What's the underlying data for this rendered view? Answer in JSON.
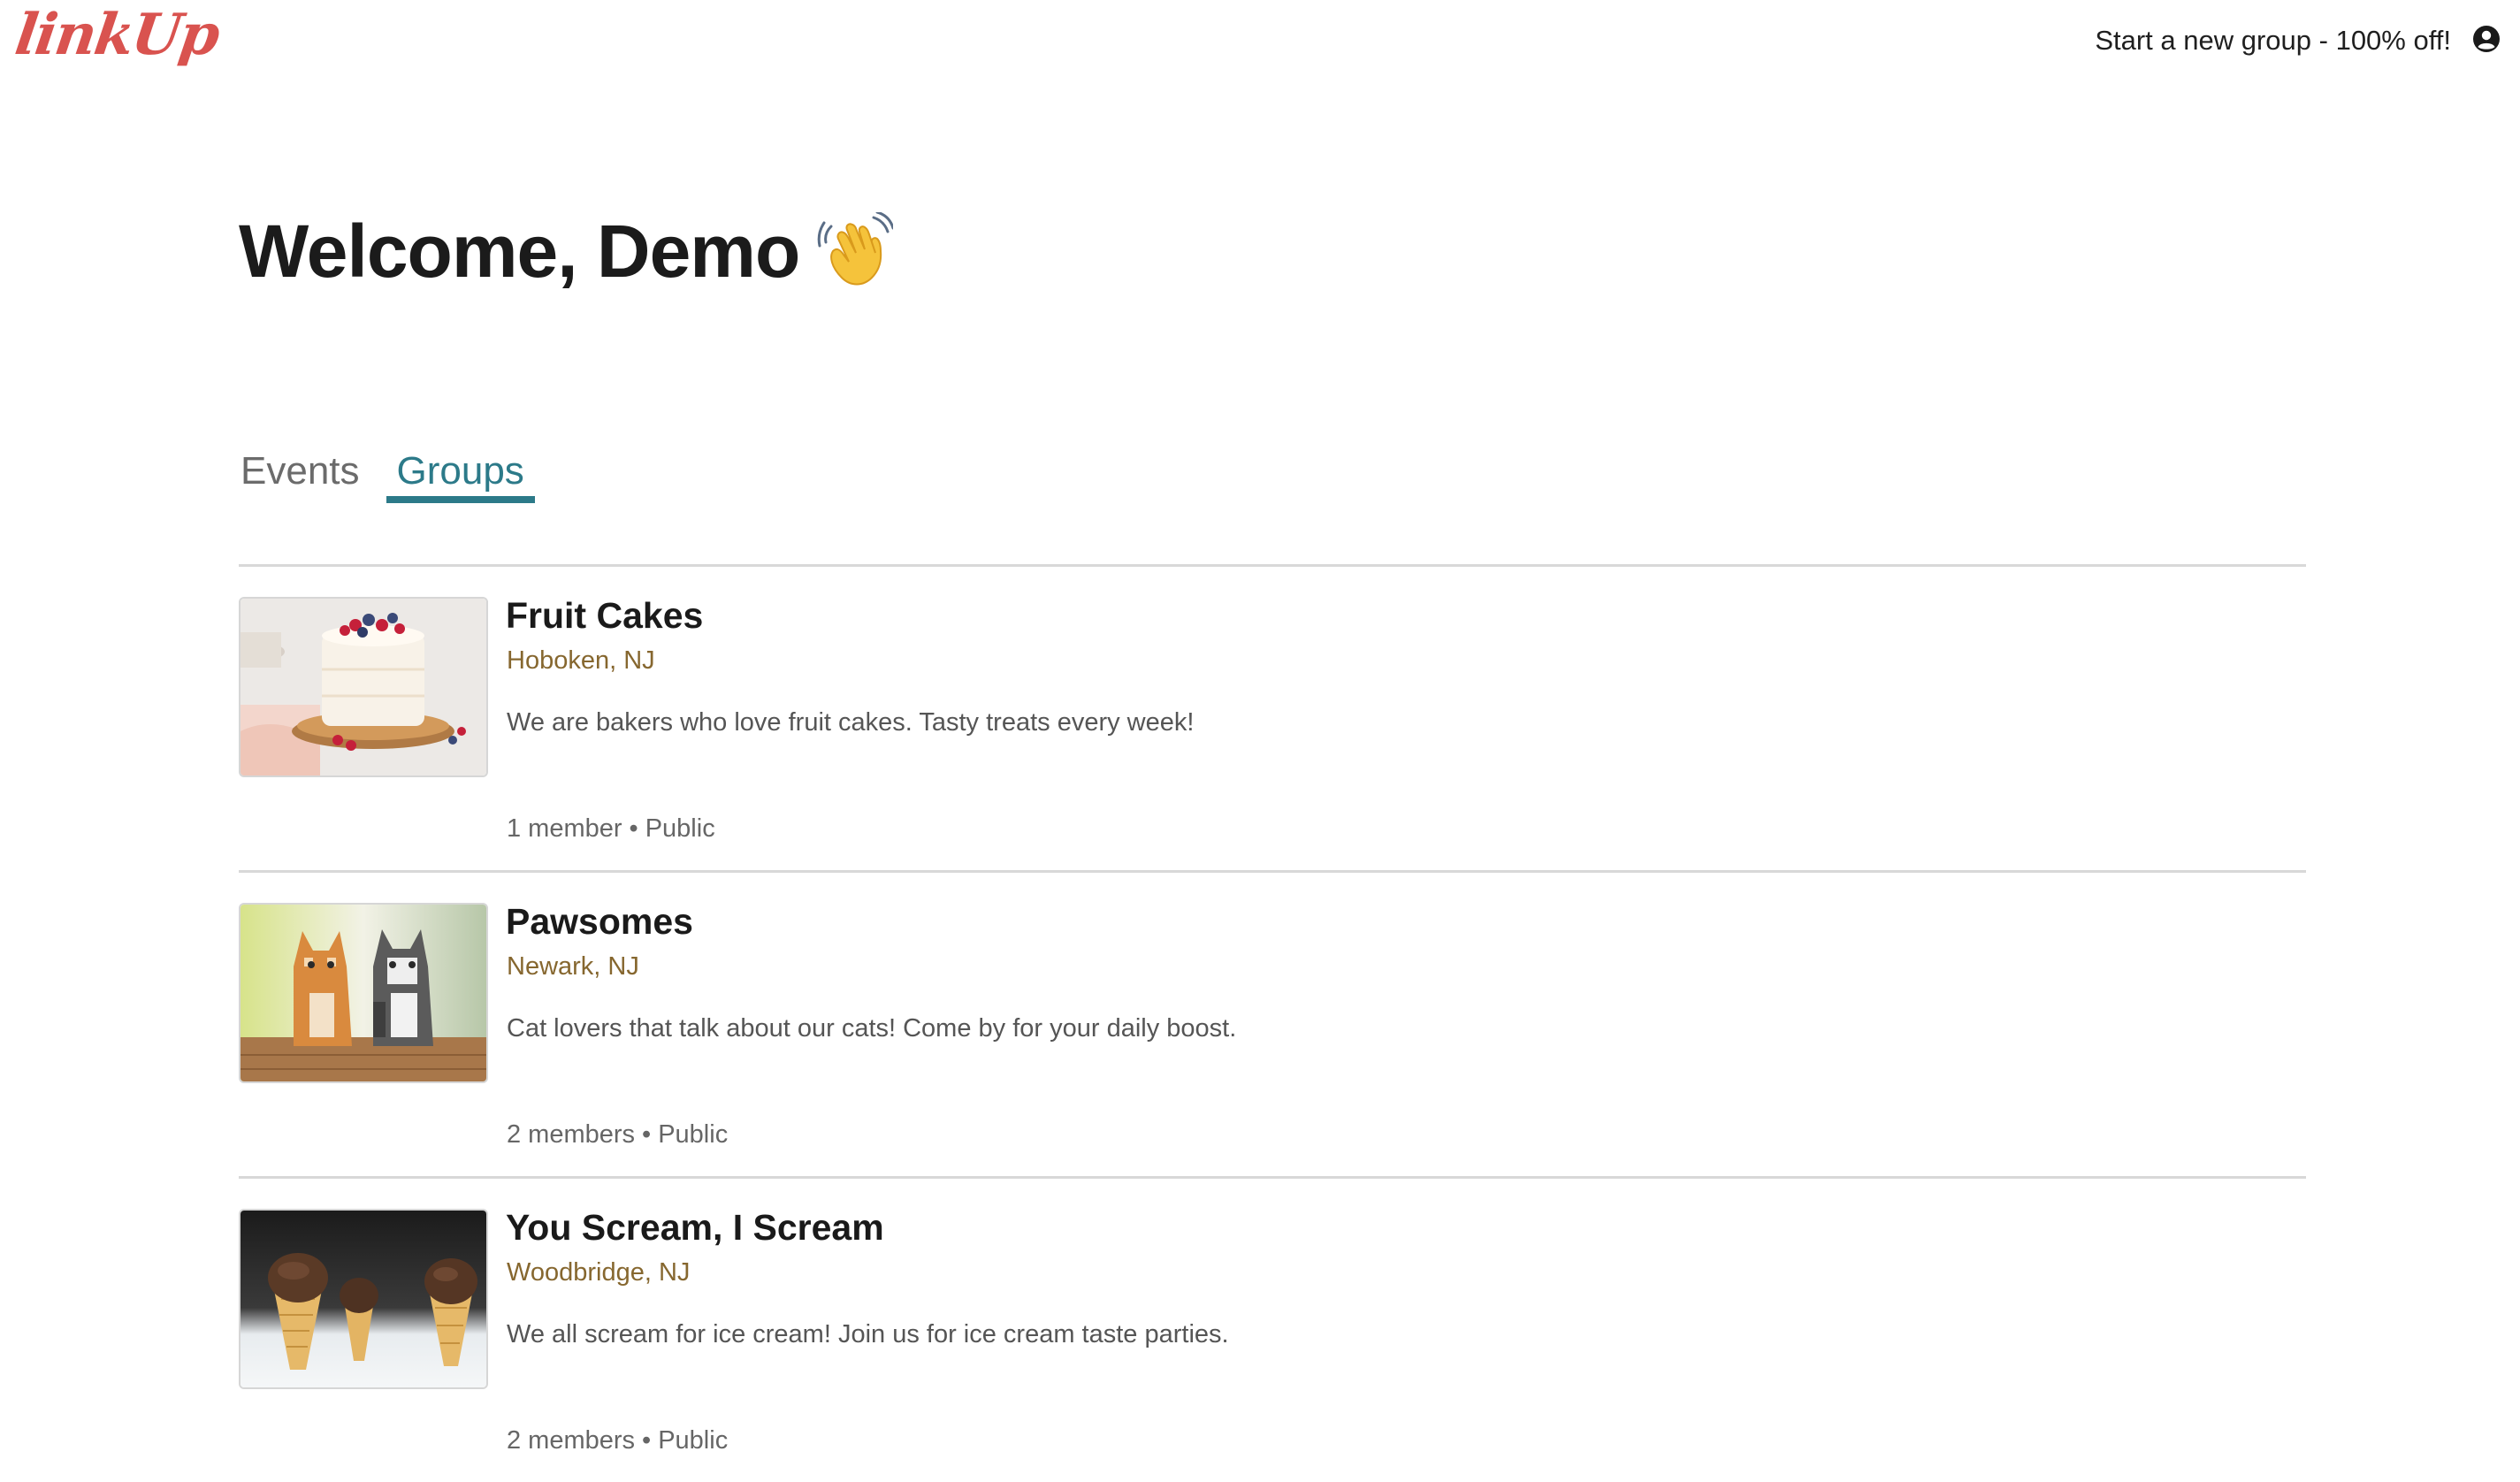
{
  "header": {
    "logo_text": "linkUp",
    "promo_link": "Start a new group - 100% off!",
    "profile_icon": "user-circle-icon",
    "colors": {
      "logo": "#d9534f",
      "accent": "#2c7a89"
    }
  },
  "welcome": {
    "title": "Welcome, Demo",
    "emoji_icon": "waving-hand-icon"
  },
  "tabs": [
    {
      "label": "Events",
      "active": false
    },
    {
      "label": "Groups",
      "active": true
    }
  ],
  "groups": [
    {
      "name": "Fruit Cakes",
      "location": "Hoboken, NJ",
      "description": "We are bakers who love fruit cakes. Tasty treats every week!",
      "members": "1 member",
      "separator": "•",
      "privacy": "Public",
      "image": "fruit-cake-image"
    },
    {
      "name": "Pawsomes",
      "location": "Newark, NJ",
      "description": "Cat lovers that talk about our cats! Come by for your daily boost.",
      "members": "2 members",
      "separator": "•",
      "privacy": "Public",
      "image": "cats-image"
    },
    {
      "name": "You Scream, I Scream",
      "location": "Woodbridge, NJ",
      "description": "We all scream for ice cream! Join us for ice cream taste parties.",
      "members": "2 members",
      "separator": "•",
      "privacy": "Public",
      "image": "ice-cream-image"
    }
  ]
}
